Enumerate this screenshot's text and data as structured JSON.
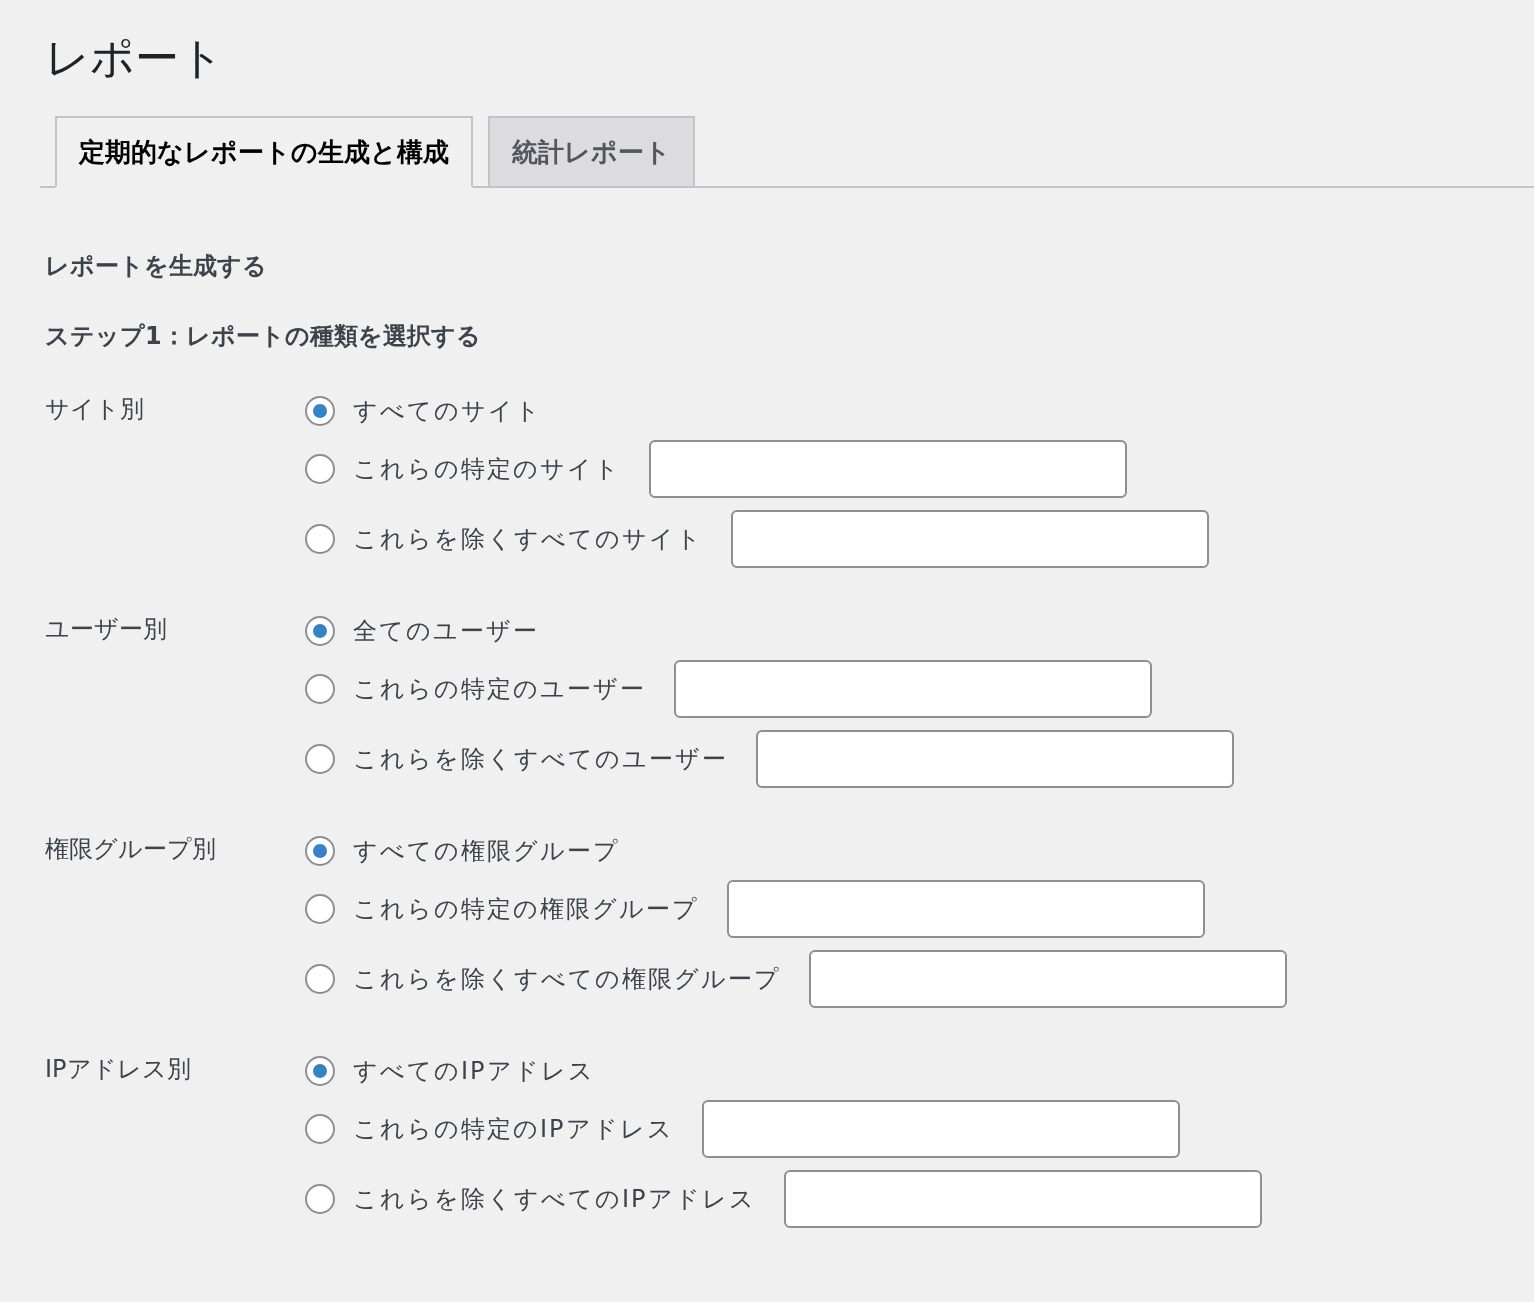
{
  "title": "レポート",
  "tabs": [
    {
      "label": "定期的なレポートの生成と構成",
      "selected": true
    },
    {
      "label": "統計レポート",
      "selected": false
    }
  ],
  "section_heading": "レポートを生成する",
  "step_heading": "ステップ1：レポートの種類を選択する",
  "groups": [
    {
      "label": "サイト別",
      "options": [
        {
          "label": "すべてのサイト",
          "selected": true,
          "kind": "plain"
        },
        {
          "label": "これらの特定のサイト",
          "selected": false,
          "kind": "input"
        },
        {
          "label": "これらを除くすべてのサイト",
          "selected": false,
          "kind": "input"
        }
      ]
    },
    {
      "label": "ユーザー別",
      "options": [
        {
          "label": "全てのユーザー",
          "selected": true,
          "kind": "plain"
        },
        {
          "label": "これらの特定のユーザー",
          "selected": false,
          "kind": "input"
        },
        {
          "label": "これらを除くすべてのユーザー",
          "selected": false,
          "kind": "input"
        }
      ]
    },
    {
      "label": "権限グループ別",
      "options": [
        {
          "label": "すべての権限グループ",
          "selected": true,
          "kind": "plain"
        },
        {
          "label": "これらの特定の権限グループ",
          "selected": false,
          "kind": "input"
        },
        {
          "label": "これらを除くすべての権限グループ",
          "selected": false,
          "kind": "input"
        }
      ]
    },
    {
      "label": "IPアドレス別",
      "options": [
        {
          "label": "すべてのIPアドレス",
          "selected": true,
          "kind": "plain"
        },
        {
          "label": "これらの特定のIPアドレス",
          "selected": false,
          "kind": "input"
        },
        {
          "label": "これらを除くすべてのIPアドレス",
          "selected": false,
          "kind": "input"
        }
      ]
    }
  ]
}
